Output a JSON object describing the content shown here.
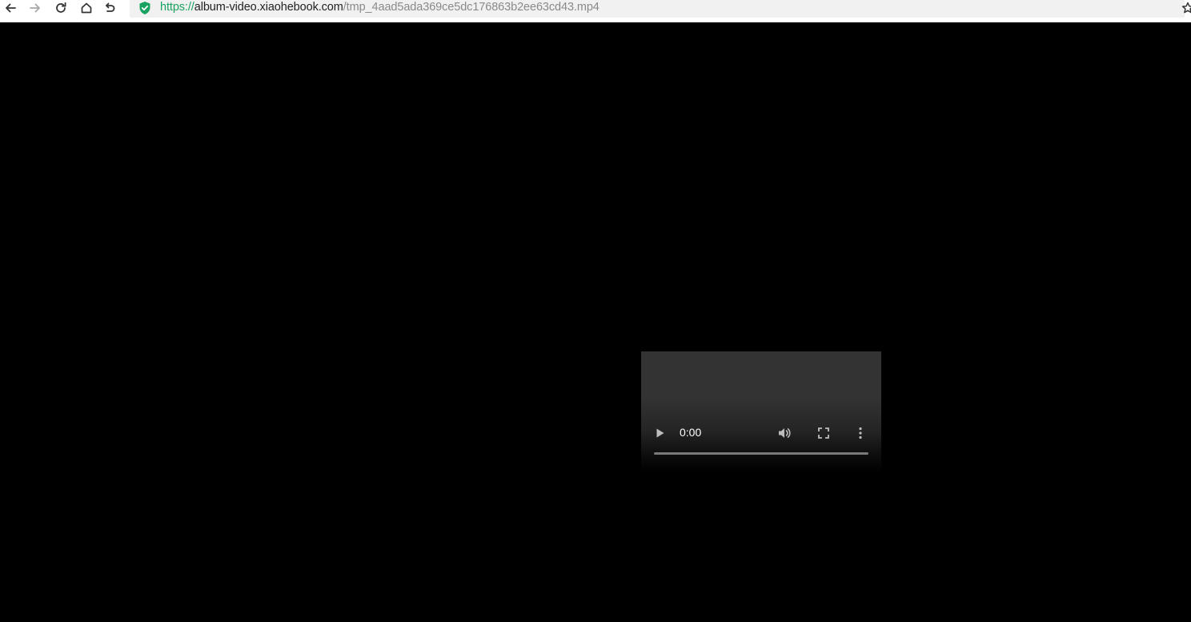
{
  "browser": {
    "url": {
      "scheme": "https://",
      "host": "album-video.xiaohebook.com",
      "path": "/tmp_4aad5ada369ce5dc176863b2ee63cd43.mp4"
    },
    "icons": {
      "back": "back-arrow-icon",
      "forward": "forward-arrow-icon",
      "reload": "reload-icon",
      "home": "home-icon",
      "undo": "undo-icon",
      "security": "shield-check-icon",
      "bookmark": "star-icon"
    },
    "colors": {
      "secure": "#1aa260",
      "host": "#222222",
      "path": "#8a8a8a"
    }
  },
  "video": {
    "current_time": "0:00",
    "progress": 0,
    "controls": [
      "play-icon",
      "volume-icon",
      "fullscreen-icon",
      "more-options-icon"
    ]
  }
}
